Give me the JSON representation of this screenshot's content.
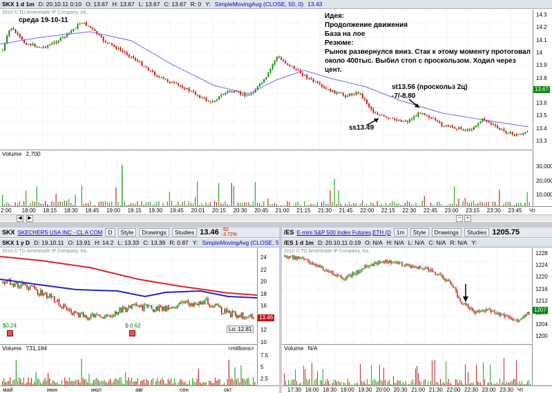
{
  "colors": {
    "up": "#0a8a0a",
    "down": "#cc1111",
    "sma": "#6666ff",
    "red_ma": "#dd2222",
    "blue_ma": "#2222cc",
    "vol": "#22aa22",
    "vol_dn": "#cc2222"
  },
  "top": {
    "header": {
      "sym": "SKX 1 d 1m",
      "d": "D: 20.10.11 0:10",
      "o": "O: 13.67",
      "h": "H: 13.67",
      "l": "L: 13.67",
      "c": "C: 13.67",
      "r": "R: 0",
      "y": "Y:",
      "sma": "SimpleMovingAvg (CLOSE, 50, 0)",
      "sma_val": "13.43"
    },
    "watermark": "2010 © TD Ameritrade IP Company, Inc.",
    "date_note": "среда 19-10-11",
    "note_lines": [
      "Идея:",
      "Продолжение движения",
      "База на лое",
      "Резюме:",
      "Рынок развернулся вниз. Стак к этому моменту протоговал",
      "около 400тыс. Выбил стоп с проскользом. Ходил через цент."
    ],
    "st_label": "st13.56 (проскольз 2ц)",
    "pl_label": "-7/-8.80",
    "ss_label": "ss13.49",
    "scale": [
      "14.3",
      "14.2",
      "14.1",
      "14",
      "13.9",
      "13.8",
      "13.7",
      "13.6",
      "13.5",
      "13.4",
      "13.3"
    ],
    "price_tag": "13.67",
    "volume_label": "Volume",
    "volume_value": "2,700",
    "vol_scale": [
      "30,000",
      "20,000",
      "10,000"
    ],
    "xaxis": [
      "2:00",
      "18:00",
      "18:15",
      "18:30",
      "18:45",
      "19:00",
      "19:15",
      "19:30",
      "19:45",
      "20:01",
      "20:15",
      "20:30",
      "20:45",
      "21:00",
      "21:15",
      "21:30",
      "21:45",
      "22:00",
      "22:15",
      "22:30",
      "22:45",
      "23:00",
      "23:15",
      "23:30",
      "23:45",
      "Чт"
    ]
  },
  "left": {
    "toolbar": {
      "sym": "SKX",
      "name": "SKECHERS USA INC - CL A COM",
      "d": "D",
      "style": "Style",
      "drawings": "Drawings",
      "studies": "Studies",
      "price": "13.46",
      "chg1": "-52",
      "chg2": "-3.72%"
    },
    "header": {
      "sym": "SKX 1 y D",
      "d": "D: 19.10.11",
      "o": "O: 13.91",
      "h": "H: 14.2",
      "l": "L: 13.33",
      "c": "C: 13.39",
      "r": "R: 0.87",
      "y": "Y:",
      "sma": "SimpleMovingAvg (CLOSE, 50, 0)"
    },
    "watermark": "2010 © TD Ameritrade IP Company, Inc.",
    "scale": [
      "24",
      "22",
      "20",
      "18",
      "16",
      "14",
      "12",
      "10"
    ],
    "price_tag": "13.46",
    "lo_label": "Lo: 12.81",
    "div1": "$0.24",
    "div2": "$-0.62",
    "volume_label": "Volume",
    "volume_value": "731,184",
    "millions": "<millions>",
    "vol_scale": [
      "7.5",
      "5",
      "2.5"
    ],
    "xaxis": [
      "май",
      "июн",
      "июл",
      "авг",
      "сен",
      "окт"
    ]
  },
  "right": {
    "toolbar": {
      "sym": "/ES",
      "name": "E-mini S&P 500 Index Futures,ETH (D",
      "tf": "1m",
      "style": "Style",
      "drawings": "Drawings",
      "studies": "Studies",
      "price": "1205.75"
    },
    "header": {
      "sym": "/ES 1 d 1m",
      "d": "D: 20.10.11 0:19",
      "o": "O: N/A",
      "h": "H: N/A",
      "l": "L: N/A",
      "c": "C: N/A",
      "r": "R: N/A",
      "y": "Y:"
    },
    "watermark": "2010 © TD Ameritrade IP Company, Inc.",
    "scale": [
      "1228",
      "1224",
      "1220",
      "1216",
      "1212",
      "1208",
      "1204",
      "1200"
    ],
    "price_tag": "1207",
    "volume_label": "Volume",
    "volume_value": "N/A",
    "xaxis": [
      "17:30",
      "18:00",
      "18:30",
      "19:00",
      "19:30",
      "20:00",
      "20:30",
      "21:00",
      "21:30",
      "22:00",
      "22:30",
      "23:00",
      "23:30",
      "Чт"
    ]
  }
}
